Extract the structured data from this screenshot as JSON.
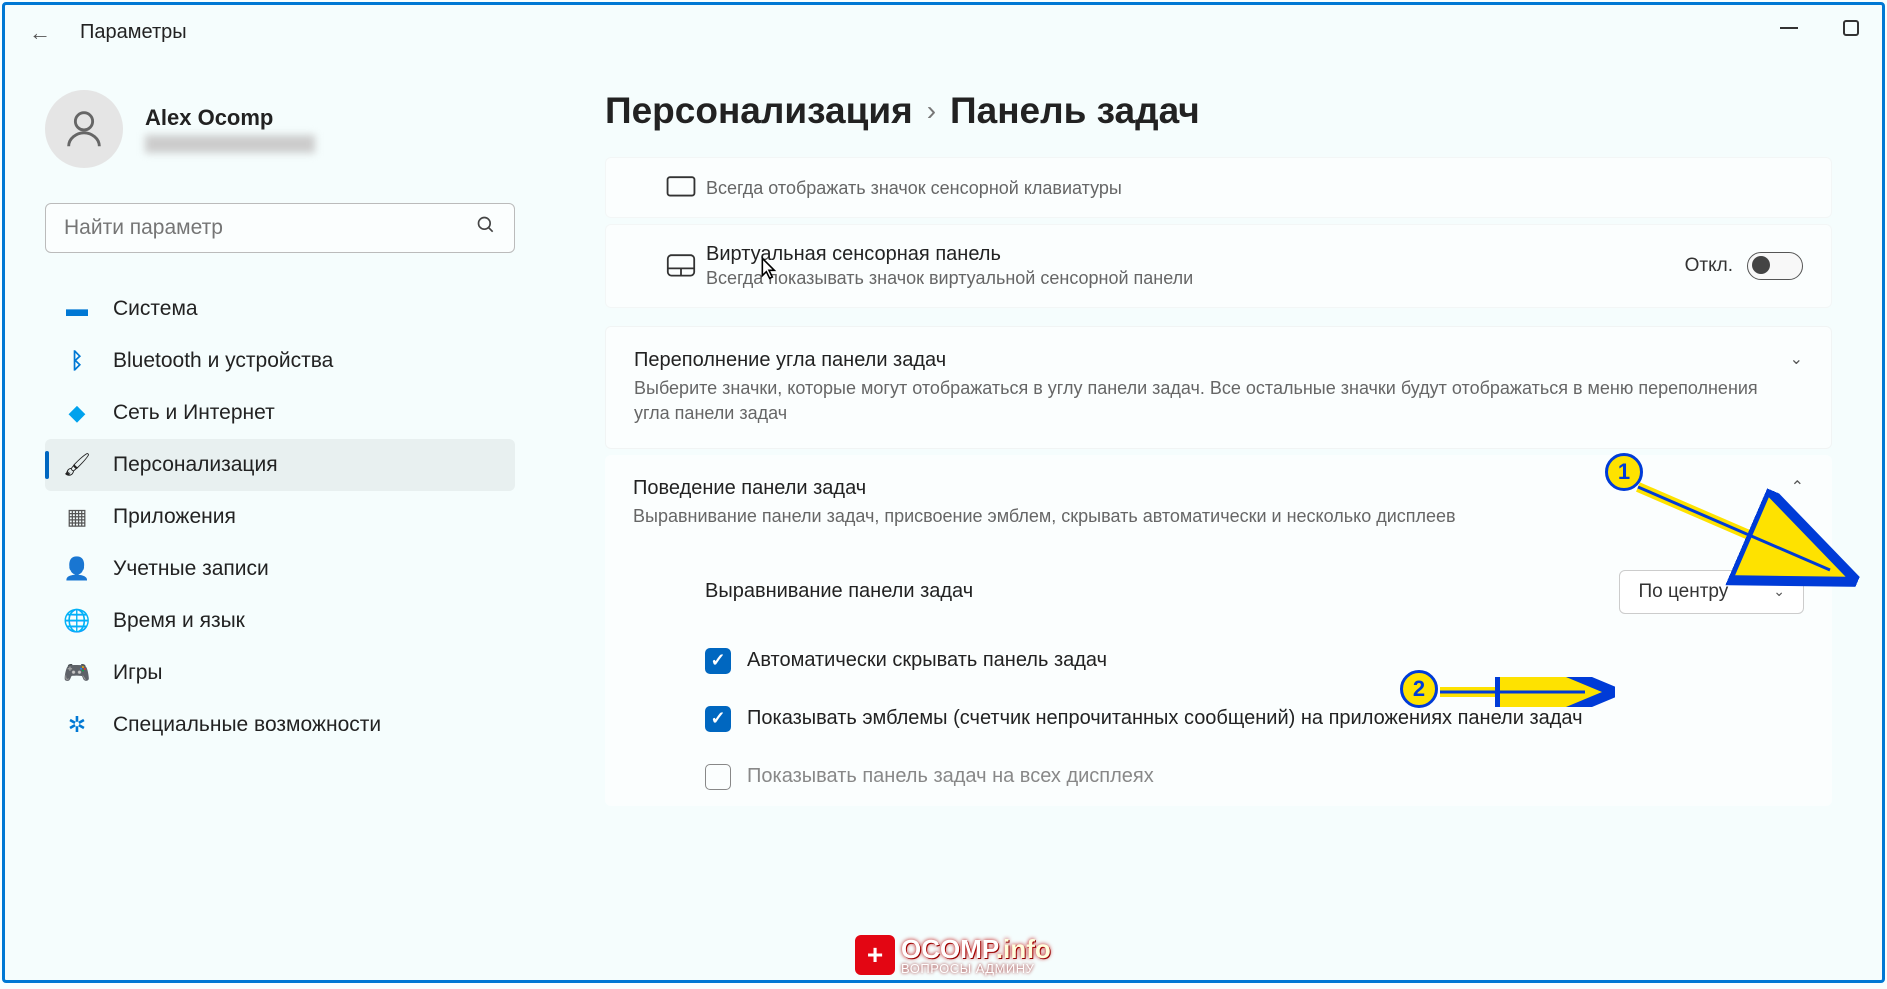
{
  "window": {
    "title": "Параметры"
  },
  "user": {
    "name": "Alex Ocomp"
  },
  "search": {
    "placeholder": "Найти параметр"
  },
  "nav": {
    "items": [
      {
        "label": "Система",
        "icon": "🖥"
      },
      {
        "label": "Bluetooth и устройства",
        "icon": "ᛒ"
      },
      {
        "label": "Сеть и Интернет",
        "icon": "🛜"
      },
      {
        "label": "Персонализация",
        "icon": "🖌"
      },
      {
        "label": "Приложения",
        "icon": "▦"
      },
      {
        "label": "Учетные записи",
        "icon": "👤"
      },
      {
        "label": "Время и язык",
        "icon": "🌐"
      },
      {
        "label": "Игры",
        "icon": "🎮"
      },
      {
        "label": "Специальные возможности",
        "icon": "♿"
      }
    ],
    "active_index": 3
  },
  "breadcrumb": {
    "parent": "Персонализация",
    "sep": "›",
    "current": "Панель задач"
  },
  "cards": {
    "touch_keyboard_desc": "Всегда отображать значок сенсорной клавиатуры",
    "virtual_touchpad": {
      "title": "Виртуальная сенсорная панель",
      "desc": "Всегда показывать значок виртуальной сенсорной панели",
      "state": "Откл."
    },
    "overflow": {
      "title": "Переполнение угла панели задач",
      "desc": "Выберите значки, которые могут отображаться в углу панели задач. Все остальные значки будут отображаться в меню переполнения угла панели задач"
    },
    "behavior": {
      "title": "Поведение панели задач",
      "desc": "Выравнивание панели задач, присвоение эмблем, скрывать автоматически и несколько дисплеев",
      "alignment_label": "Выравнивание панели задач",
      "alignment_value": "По центру",
      "auto_hide": "Автоматически скрывать панель задач",
      "badges": "Показывать эмблемы (счетчик непрочитанных сообщений) на приложениях панели задач",
      "all_displays": "Показывать панель задач на всех дисплеях"
    }
  },
  "annotations": {
    "b1": "1",
    "b2": "2"
  },
  "watermark": {
    "brand": "OCOMP",
    "domain": ".info",
    "sub": "ВОПРОСЫ АДМИНУ"
  }
}
